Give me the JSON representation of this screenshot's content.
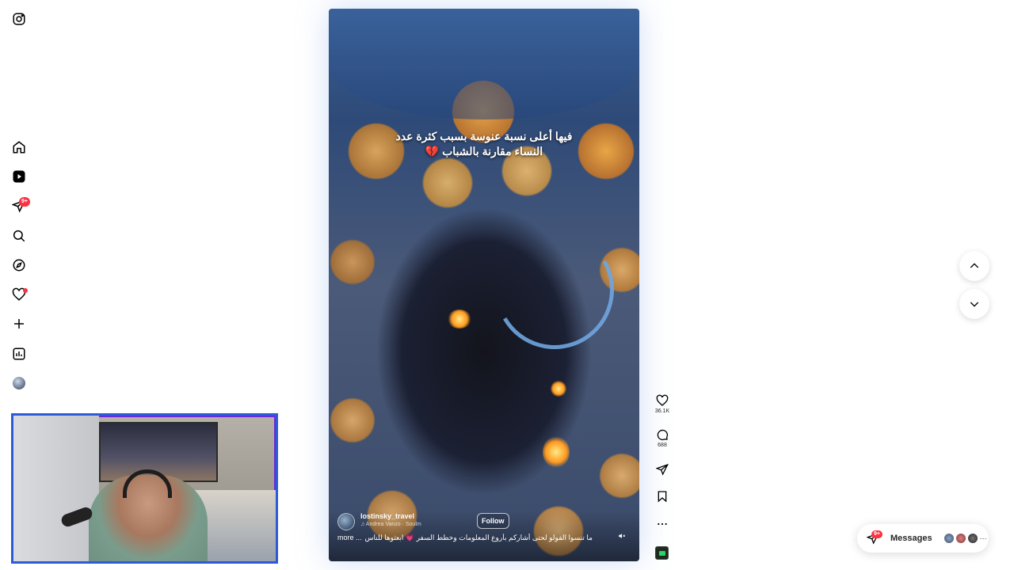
{
  "sidebar": {
    "items": [
      {
        "name": "instagram-logo",
        "label": "Instagram"
      },
      {
        "name": "home-icon",
        "label": "Home"
      },
      {
        "name": "reels-icon",
        "label": "Reels"
      },
      {
        "name": "messages-icon",
        "label": "Messages",
        "badge": "9+"
      },
      {
        "name": "search-icon",
        "label": "Search"
      },
      {
        "name": "explore-icon",
        "label": "Explore"
      },
      {
        "name": "notifications-icon",
        "label": "Notifications"
      },
      {
        "name": "create-icon",
        "label": "Create"
      },
      {
        "name": "dashboard-icon",
        "label": "Dashboard"
      },
      {
        "name": "profile-avatar",
        "label": "Profile"
      }
    ],
    "messages_badge": "9+"
  },
  "reel": {
    "overlay_text": "فيها أعلى نسبة عنوسة بسبب كثرة عدد النساء مقارنة بالشباب 💔",
    "username": "lostinsky_travel",
    "audio": "♫  Andrea Vanzo · Soulm",
    "follow_label": "Follow",
    "more_label": "more ...",
    "description": "ما تنسوا الفولو لحتى أشاركم بأروع المعلومات وخطط السفر 💗 ابعثوها للناس",
    "mute_icon": "speaker-muted-icon"
  },
  "actions": {
    "likes": "36.1K",
    "comments": "688"
  },
  "messages_bar": {
    "label": "Messages",
    "badge": "9+",
    "more": "···"
  },
  "colors": {
    "badge": "#ff3040",
    "webcam_border": "#2c5ad8",
    "text": "#262626"
  }
}
